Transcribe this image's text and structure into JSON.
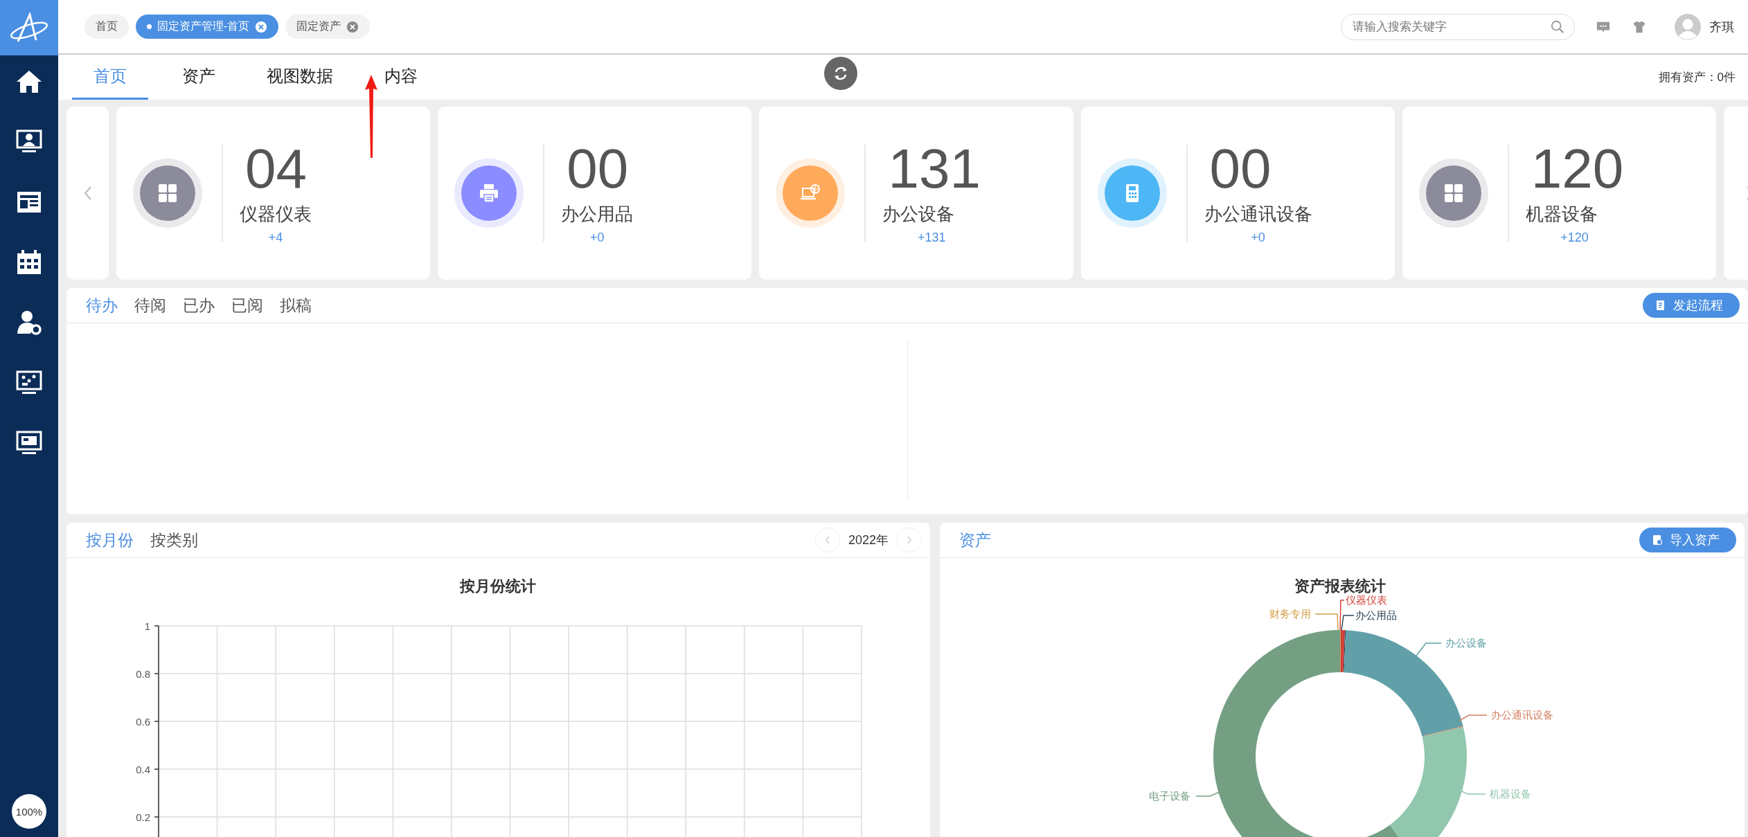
{
  "sidebar": {
    "zoom": "100%"
  },
  "tags": [
    {
      "label": "首页",
      "selected": false,
      "closable": false
    },
    {
      "label": "固定资产管理-首页",
      "selected": true,
      "closable": true
    },
    {
      "label": "固定资产",
      "selected": false,
      "closable": true
    }
  ],
  "search": {
    "placeholder": "请输入搜索关键字"
  },
  "user": {
    "name": "齐琪"
  },
  "tabs": [
    {
      "label": "首页",
      "selected": true
    },
    {
      "label": "资产",
      "selected": false
    },
    {
      "label": "视图数据",
      "selected": false
    },
    {
      "label": "内容",
      "selected": false
    }
  ],
  "asset_count": "拥有资产：0件",
  "cards": [
    {
      "kind": "grid",
      "color": "#8b8b9b",
      "value": "04",
      "label": "仪器仪表",
      "delta": "+4"
    },
    {
      "kind": "printer",
      "color": "#8a8cff",
      "value": "00",
      "label": "办公用品",
      "delta": "+0"
    },
    {
      "kind": "laptop",
      "color": "#ffa95a",
      "value": "131",
      "label": "办公设备",
      "delta": "+131"
    },
    {
      "kind": "phone",
      "color": "#4db6f4",
      "value": "00",
      "label": "办公通讯设备",
      "delta": "+0"
    },
    {
      "kind": "grid",
      "color": "#8b8b9b",
      "value": "120",
      "label": "机器设备",
      "delta": "+120"
    }
  ],
  "todo": {
    "tabs": [
      {
        "label": "待办",
        "selected": true
      },
      {
        "label": "待阅",
        "selected": false
      },
      {
        "label": "已办",
        "selected": false
      },
      {
        "label": "已阅",
        "selected": false
      },
      {
        "label": "拟稿",
        "selected": false
      }
    ],
    "button": "发起流程"
  },
  "monthly": {
    "tabs": [
      {
        "label": "按月份",
        "selected": true
      },
      {
        "label": "按类别",
        "selected": false
      }
    ],
    "year": "2022年",
    "chart_title": "按月份统计",
    "y_axis_labels": [
      "1",
      "0.8",
      "0.6",
      "0.4",
      "0.2"
    ]
  },
  "assets": {
    "title": "资产",
    "button": "导入资产",
    "chart_title": "资产报表统计",
    "labels": [
      {
        "label": "财务专用",
        "color": "#d4a046"
      },
      {
        "label": "仪器仪表",
        "color": "#d0403a"
      },
      {
        "label": "办公用品",
        "color": "#2f4554"
      },
      {
        "label": "办公设备",
        "color": "#61a0a8"
      },
      {
        "label": "办公通讯设备",
        "color": "#d48265"
      },
      {
        "label": "机器设备",
        "color": "#91c7ae"
      },
      {
        "label": "电子设备",
        "color": "#749f83"
      }
    ]
  }
}
